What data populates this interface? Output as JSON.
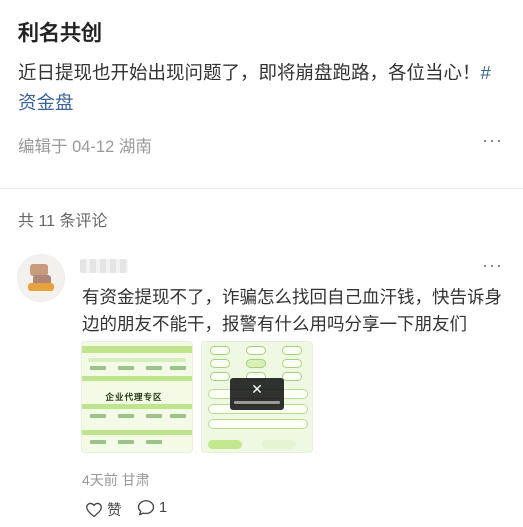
{
  "post": {
    "title": "利名共创",
    "body": "近日提现也开始出现问题了，即将崩盘跑路，各位当心！",
    "hashtag": "#资金盘",
    "meta": "编辑于 04-12 湖南",
    "more": "···"
  },
  "comments_header": "共 11 条评论",
  "comment": {
    "text": "有资金提现不了，诈骗怎么找回自己血汗钱，快告诉身边的朋友不能干，报警有什么用吗分享一下朋友们",
    "more": "···",
    "meta": "4天前 甘肃",
    "image1": {
      "heading": "企业代理专区"
    },
    "image2": {
      "overlay_icon": "✕"
    },
    "actions": {
      "like_label": "赞",
      "reply_count": "1"
    }
  },
  "icons": {
    "like": "heart-outline-icon",
    "reply": "comment-bubble-icon"
  },
  "colors": {
    "hashtag": "#3d6498",
    "meta": "#999999",
    "thumb_green": "#bfe48d"
  }
}
